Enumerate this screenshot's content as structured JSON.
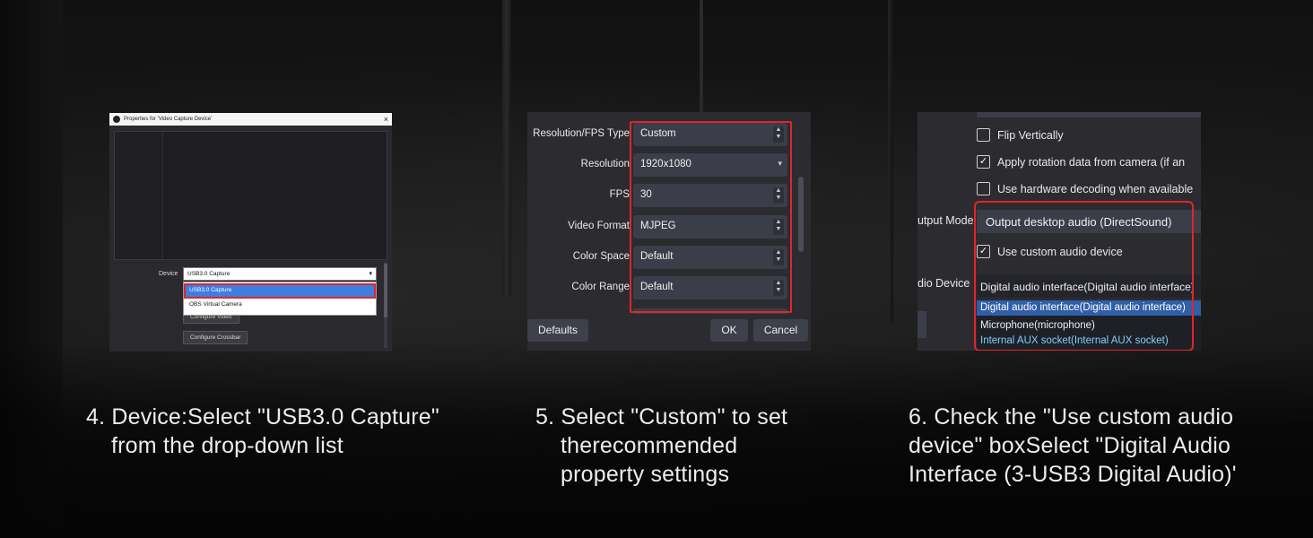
{
  "colors": {
    "highlight": "#e0252e",
    "selection": "#3d7ee0",
    "panel_bg": "#2b2b30"
  },
  "panel1": {
    "window_title": "Properties for 'Video Capture Device'",
    "close_icon": "×",
    "device_label": "Device",
    "device_value": "USB3.0 Capture",
    "dropdown_options": [
      "USB3.0 Capture",
      "OBS Virtual Camera"
    ],
    "configure_video_label": "Configure Video",
    "configure_crossbar_label": "Configure Crossbar"
  },
  "panel2": {
    "rows": [
      {
        "label": "Resolution/FPS Type",
        "value": "Custom",
        "control": "spin"
      },
      {
        "label": "Resolution",
        "value": "1920x1080",
        "control": "dropdown"
      },
      {
        "label": "FPS",
        "value": "30",
        "control": "spin"
      },
      {
        "label": "Video Format",
        "value": "MJPEG",
        "control": "spin"
      },
      {
        "label": "Color Space",
        "value": "Default",
        "control": "spin"
      },
      {
        "label": "Color Range",
        "value": "Default",
        "control": "spin"
      }
    ],
    "defaults_label": "Defaults",
    "ok_label": "OK",
    "cancel_label": "Cancel"
  },
  "panel3": {
    "flip_vertically": {
      "label": "Flip Vertically",
      "checked": false
    },
    "apply_rotation": {
      "label": "Apply rotation data from camera (if an",
      "checked": true
    },
    "hw_decoding": {
      "label": "Use hardware decoding when available",
      "checked": false
    },
    "output_mode_label": "utput Mode",
    "output_mode_value": "Output desktop audio (DirectSound)",
    "use_custom_audio": {
      "label": "Use custom audio device",
      "checked": true
    },
    "audio_device_label": "dio Device",
    "audio_device_value": "Digital audio interface(Digital audio interface)",
    "audio_options": [
      "Digital audio interface(Digital audio interface)",
      "Microphone(microphone)",
      "Internal AUX socket(Internal AUX socket)"
    ]
  },
  "captions": {
    "step4": [
      "4. Device:Select \"USB3.0 Capture\"",
      "from the drop-down list"
    ],
    "step5": [
      "5. Select \"Custom\" to set",
      "therecommended",
      "property settings"
    ],
    "step6": [
      "6. Check the \"Use custom audio",
      "device\" boxSelect \"Digital Audio",
      "Interface (3-USB3 Digital Audio)'"
    ]
  }
}
